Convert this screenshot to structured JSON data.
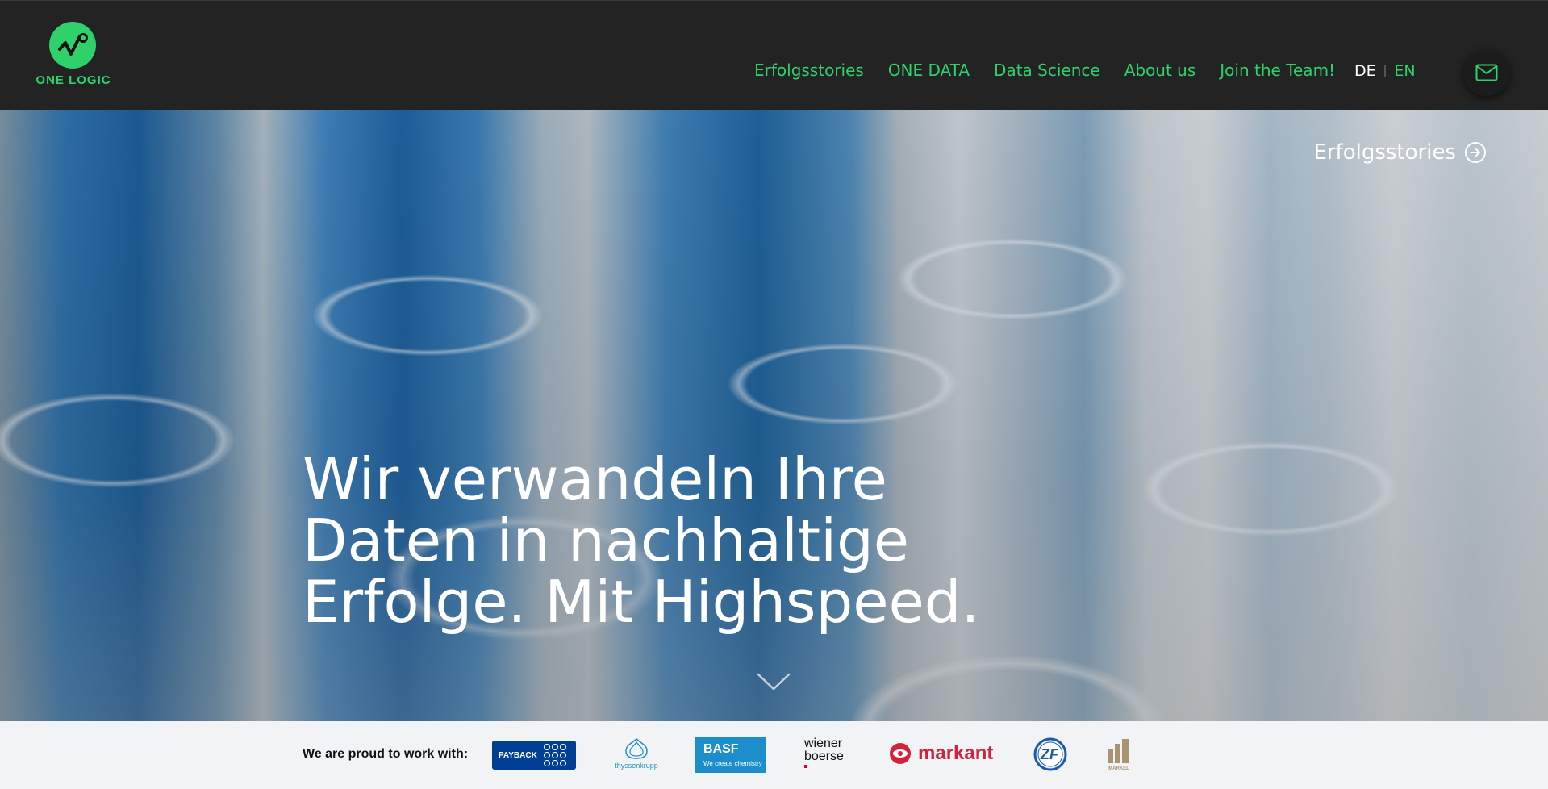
{
  "brand": {
    "name": "ONE LOGIC",
    "accent": "#2fd26a",
    "header_bg": "#232323"
  },
  "nav": {
    "items": [
      {
        "label": "Erfolgsstories"
      },
      {
        "label": "ONE DATA"
      },
      {
        "label": "Data Science"
      },
      {
        "label": "About us"
      },
      {
        "label": "Join the Team!"
      }
    ]
  },
  "language": {
    "active": "DE",
    "separator": "|",
    "other": "EN"
  },
  "contact": {
    "icon": "mail-icon"
  },
  "hero": {
    "link_label": "Erfolgsstories",
    "link_icon": "arrow-circle-right-icon",
    "title_line1": "Wir verwandeln Ihre",
    "title_line2": "Daten in nachhaltige",
    "title_line3": "Erfolge. Mit Highspeed.",
    "scroll_icon": "chevron-down-icon"
  },
  "partners": {
    "label": "We are proud to work with:",
    "logos": {
      "payback": "PAYBACK",
      "thyssenkrupp": "thyssenkrupp",
      "basf": "BASF",
      "basf_tagline": "We create chemistry",
      "wiener_line1": "wiener",
      "wiener_line2": "boerse",
      "markant": "markant",
      "zf": "ZF",
      "markel": "MARKEL"
    }
  }
}
